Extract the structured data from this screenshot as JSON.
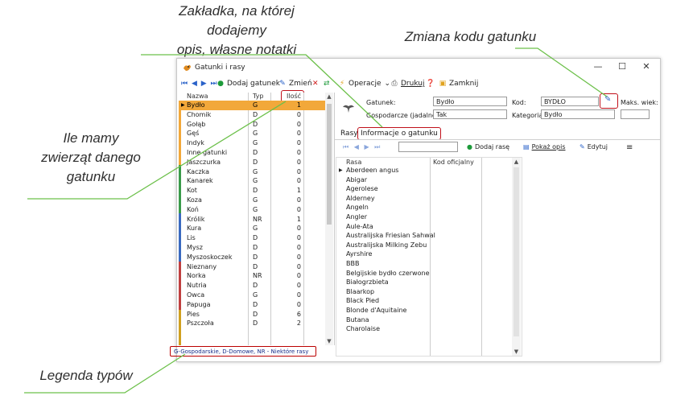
{
  "annotations": {
    "tab_note_line1": "Zakładka, na której dodajemy",
    "tab_note_line2": "opis, własne notatki",
    "code_change": "Zmiana kodu gatunku",
    "count_line1": "Ile mamy",
    "count_line2": "zwierząt danego",
    "count_line3": "gatunku",
    "legend_note": "Legenda typów"
  },
  "window": {
    "title": "Gatunki i rasy",
    "minimize": "—",
    "maximize": "☐",
    "close": "✕"
  },
  "toolbar": {
    "nav": "⏮ ◀ ▶ ⏭",
    "add": "Dodaj gatunek",
    "edit": "Zmień",
    "operations": "Operacje",
    "print": "Drukuj",
    "close": "Zamknij"
  },
  "species_list": {
    "headers": {
      "name": "Nazwa",
      "type": "Typ",
      "count": "Ilość"
    },
    "rows": [
      {
        "name": "Bydło",
        "type": "G",
        "count": "1",
        "selected": true
      },
      {
        "name": "Chomik",
        "type": "D",
        "count": "0"
      },
      {
        "name": "Gołąb",
        "type": "D",
        "count": "0"
      },
      {
        "name": "Gęś",
        "type": "G",
        "count": "0"
      },
      {
        "name": "Indyk",
        "type": "G",
        "count": "0"
      },
      {
        "name": "Inne gatunki",
        "type": "D",
        "count": "0"
      },
      {
        "name": "Jaszczurka",
        "type": "D",
        "count": "0"
      },
      {
        "name": "Kaczka",
        "type": "G",
        "count": "0"
      },
      {
        "name": "Kanarek",
        "type": "G",
        "count": "0"
      },
      {
        "name": "Kot",
        "type": "D",
        "count": "1"
      },
      {
        "name": "Koza",
        "type": "G",
        "count": "0"
      },
      {
        "name": "Koń",
        "type": "G",
        "count": "0"
      },
      {
        "name": "Królik",
        "type": "NR",
        "count": "1"
      },
      {
        "name": "Kura",
        "type": "G",
        "count": "0"
      },
      {
        "name": "Lis",
        "type": "D",
        "count": "0"
      },
      {
        "name": "Mysz",
        "type": "D",
        "count": "0"
      },
      {
        "name": "Myszoskoczek",
        "type": "D",
        "count": "0"
      },
      {
        "name": "Nieznany",
        "type": "D",
        "count": "0"
      },
      {
        "name": "Norka",
        "type": "NR",
        "count": "0"
      },
      {
        "name": "Nutria",
        "type": "D",
        "count": "0"
      },
      {
        "name": "Owca",
        "type": "G",
        "count": "0"
      },
      {
        "name": "Papuga",
        "type": "D",
        "count": "0"
      },
      {
        "name": "Pies",
        "type": "D",
        "count": "6"
      },
      {
        "name": "Pszczoła",
        "type": "D",
        "count": "2"
      }
    ],
    "legend": "G-Gospodarskie, D-Domowe, NR - Niektóre rasy"
  },
  "form": {
    "species_label": "Gatunek:",
    "species_value": "Bydło",
    "farm_label": "Gospodarcze (jadalne):",
    "farm_value": "Tak",
    "code_label": "Kod:",
    "code_value": "BYDŁO",
    "category_label": "Kategoria:",
    "category_value": "Bydło",
    "max_age_label": "Maks. wiek:",
    "max_age_value": ""
  },
  "tabs": {
    "breeds": "Rasy",
    "info": "Informacje o gatunku"
  },
  "subtoolbar": {
    "nav": "⏮ ◀ ▶ ⏭",
    "add_breed": "Dodaj rasę",
    "show_desc": "Pokaż opis",
    "edit": "Edytuj",
    "menu": "≡"
  },
  "breeds": {
    "headers": {
      "breed": "Rasa",
      "official_code": "Kod oficjalny"
    },
    "rows": [
      "Aberdeen angus",
      "Abigar",
      "Agerolese",
      "Alderney",
      "Angeln",
      "Angler",
      "Aule-Ata",
      "Australijska Friesian Sahwal",
      "Australijska Milking Zebu",
      "Ayrshire",
      "BBB",
      "Belgijskie bydło czerwone",
      "Białogrzbieta",
      "Blaarkop",
      "Black Pied",
      "Blonde d'Aquitaine",
      "Butana",
      "Charolaise"
    ]
  }
}
